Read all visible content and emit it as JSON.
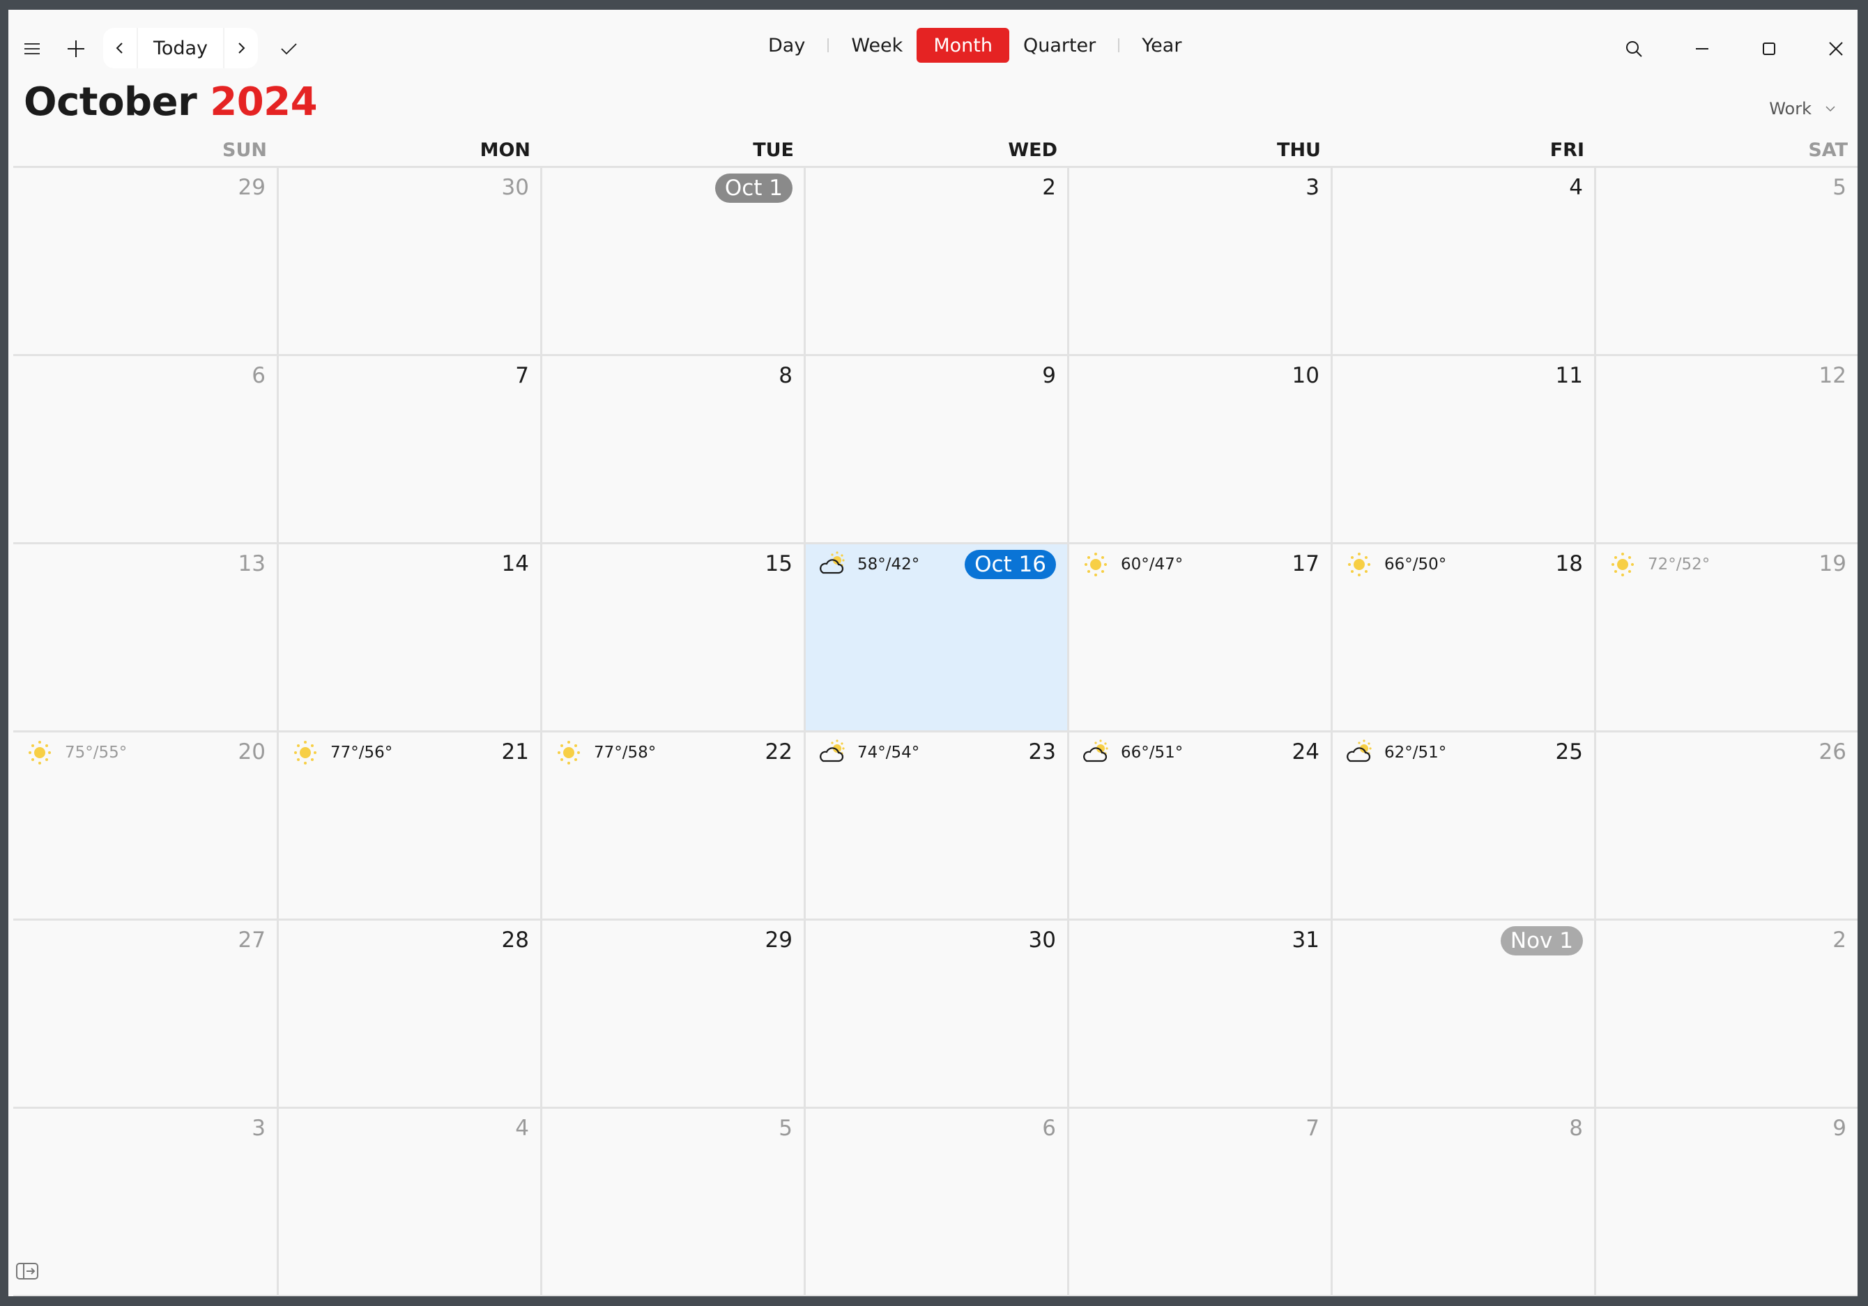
{
  "toolbar": {
    "today_label": "Today",
    "views": [
      {
        "label": "Day",
        "active": false
      },
      {
        "label": "Week",
        "active": false
      },
      {
        "label": "Month",
        "active": true
      },
      {
        "label": "Quarter",
        "active": false
      },
      {
        "label": "Year",
        "active": false
      }
    ],
    "accent_color": "#e52323"
  },
  "header": {
    "month": "October",
    "year": "2024",
    "calendar_selector": "Work"
  },
  "days_of_week": [
    "SUN",
    "MON",
    "TUE",
    "WED",
    "THU",
    "FRI",
    "SAT"
  ],
  "today_color": "#0a74d6",
  "weeks": [
    [
      {
        "label": "29",
        "in_month": false
      },
      {
        "label": "30",
        "in_month": false
      },
      {
        "label": "Oct 1",
        "in_month": true,
        "badge": "gray"
      },
      {
        "label": "2",
        "in_month": true
      },
      {
        "label": "3",
        "in_month": true
      },
      {
        "label": "4",
        "in_month": true
      },
      {
        "label": "5",
        "in_month": true,
        "weekend": true
      }
    ],
    [
      {
        "label": "6",
        "in_month": true,
        "weekend": true
      },
      {
        "label": "7",
        "in_month": true
      },
      {
        "label": "8",
        "in_month": true
      },
      {
        "label": "9",
        "in_month": true
      },
      {
        "label": "10",
        "in_month": true
      },
      {
        "label": "11",
        "in_month": true
      },
      {
        "label": "12",
        "in_month": true,
        "weekend": true
      }
    ],
    [
      {
        "label": "13",
        "in_month": true,
        "weekend": true
      },
      {
        "label": "14",
        "in_month": true
      },
      {
        "label": "15",
        "in_month": true
      },
      {
        "label": "Oct 16",
        "in_month": true,
        "today": true,
        "badge": "blue",
        "weather": {
          "icon": "partly-cloudy",
          "temps": "58°/42°"
        }
      },
      {
        "label": "17",
        "in_month": true,
        "weather": {
          "icon": "sunny",
          "temps": "60°/47°"
        }
      },
      {
        "label": "18",
        "in_month": true,
        "weather": {
          "icon": "sunny",
          "temps": "66°/50°"
        }
      },
      {
        "label": "19",
        "in_month": true,
        "weekend": true,
        "weather": {
          "icon": "sunny",
          "temps": "72°/52°"
        }
      }
    ],
    [
      {
        "label": "20",
        "in_month": true,
        "weekend": true,
        "weather": {
          "icon": "sunny",
          "temps": "75°/55°"
        }
      },
      {
        "label": "21",
        "in_month": true,
        "weather": {
          "icon": "sunny",
          "temps": "77°/56°"
        }
      },
      {
        "label": "22",
        "in_month": true,
        "weather": {
          "icon": "sunny",
          "temps": "77°/58°"
        }
      },
      {
        "label": "23",
        "in_month": true,
        "weather": {
          "icon": "partly-cloudy",
          "temps": "74°/54°"
        }
      },
      {
        "label": "24",
        "in_month": true,
        "weather": {
          "icon": "partly-cloudy",
          "temps": "66°/51°"
        }
      },
      {
        "label": "25",
        "in_month": true,
        "weather": {
          "icon": "partly-cloudy",
          "temps": "62°/51°"
        }
      },
      {
        "label": "26",
        "in_month": true,
        "weekend": true
      }
    ],
    [
      {
        "label": "27",
        "in_month": true,
        "weekend": true
      },
      {
        "label": "28",
        "in_month": true
      },
      {
        "label": "29",
        "in_month": true
      },
      {
        "label": "30",
        "in_month": true
      },
      {
        "label": "31",
        "in_month": true
      },
      {
        "label": "Nov 1",
        "in_month": false,
        "badge": "lightgray"
      },
      {
        "label": "2",
        "in_month": false
      }
    ],
    [
      {
        "label": "3",
        "in_month": false
      },
      {
        "label": "4",
        "in_month": false
      },
      {
        "label": "5",
        "in_month": false
      },
      {
        "label": "6",
        "in_month": false
      },
      {
        "label": "7",
        "in_month": false
      },
      {
        "label": "8",
        "in_month": false
      },
      {
        "label": "9",
        "in_month": false
      }
    ]
  ]
}
